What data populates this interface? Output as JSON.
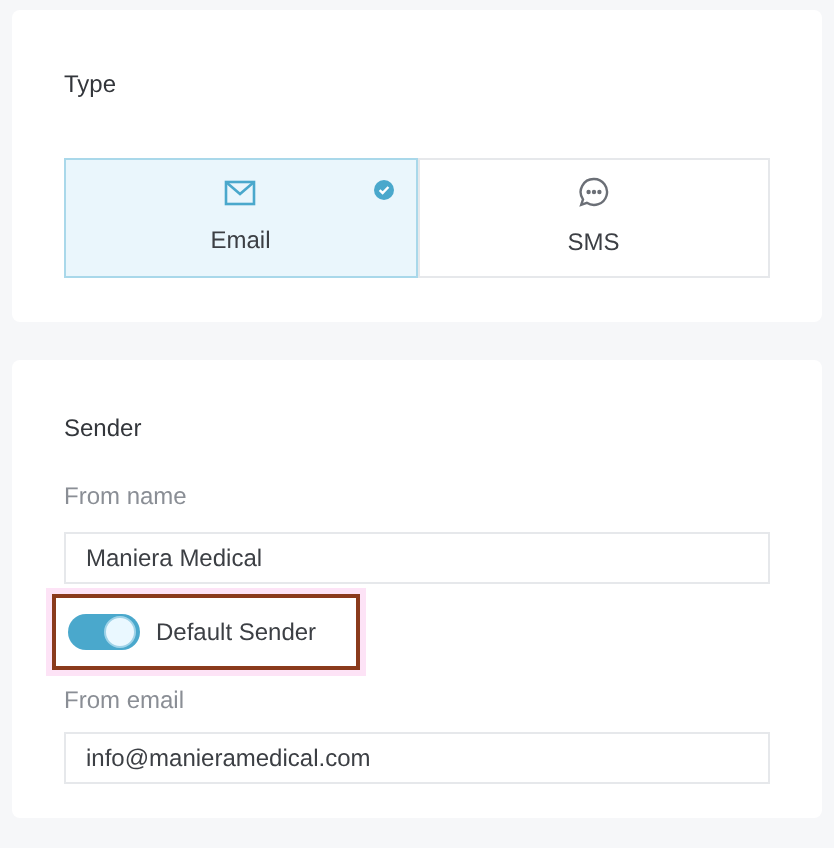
{
  "type_section": {
    "title": "Type",
    "options": [
      {
        "kind": "email",
        "label": "Email",
        "selected": true
      },
      {
        "kind": "sms",
        "label": "SMS",
        "selected": false
      }
    ]
  },
  "sender_section": {
    "title": "Sender",
    "from_name": {
      "label": "From name",
      "value": "Maniera Medical"
    },
    "default_sender": {
      "label": "Default Sender",
      "on": true,
      "highlighted": true
    },
    "from_email": {
      "label": "From email",
      "value": "info@manieramedical.com"
    }
  }
}
